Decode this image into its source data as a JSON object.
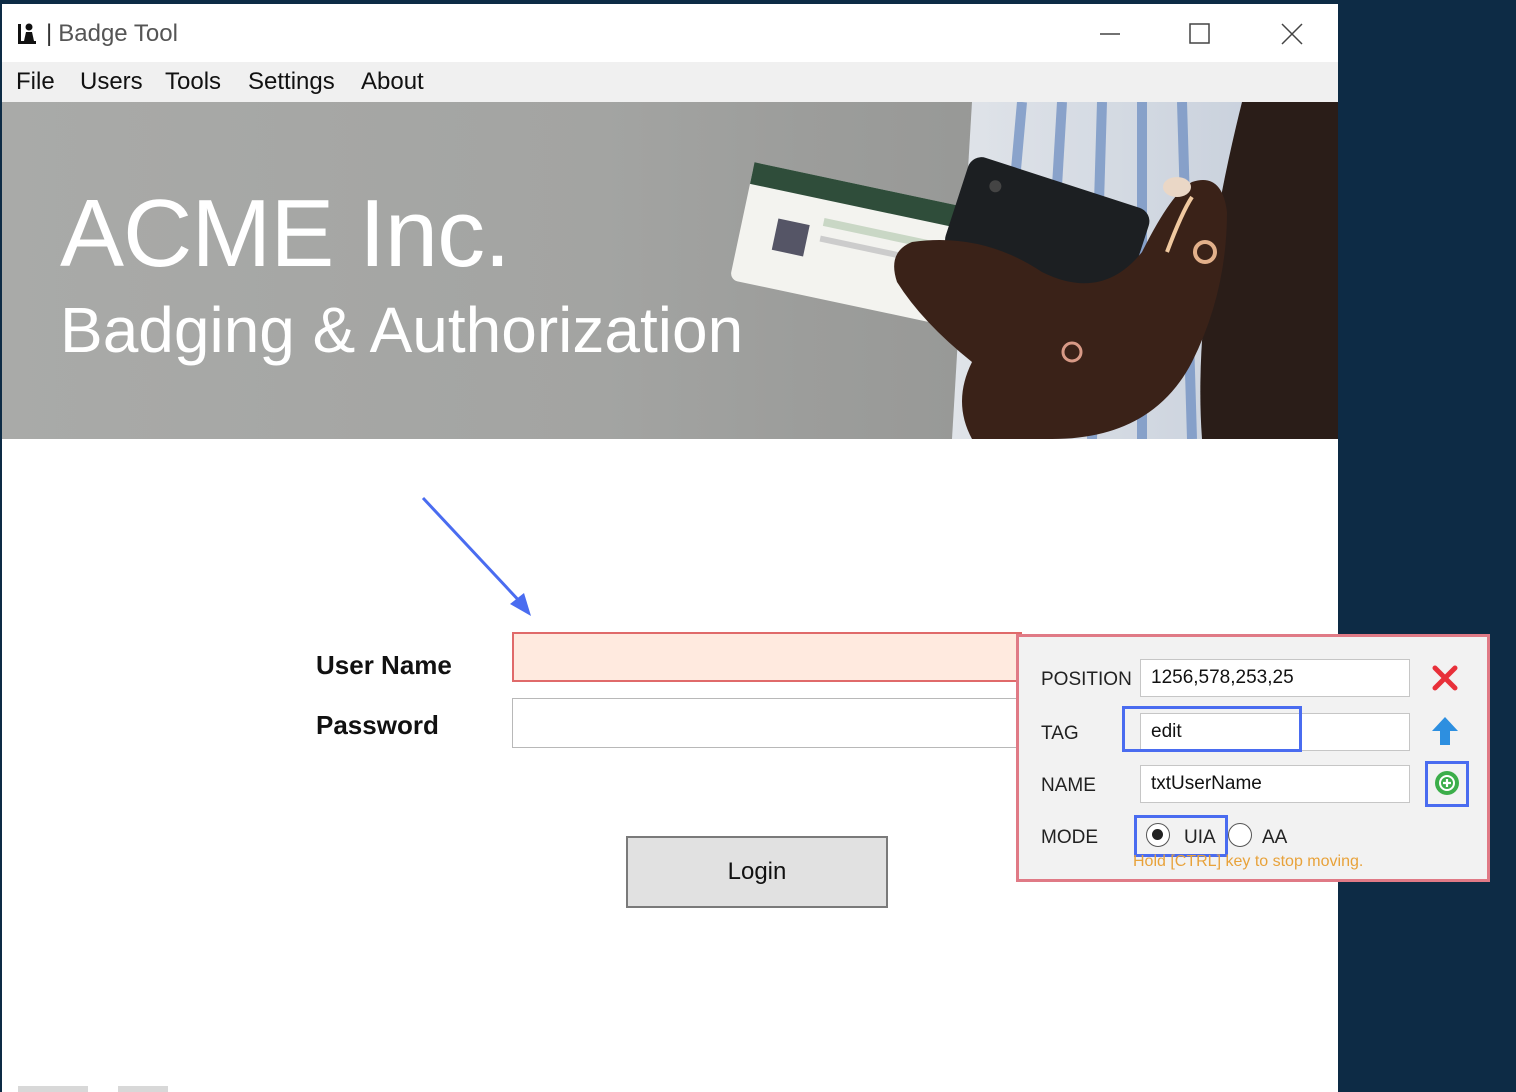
{
  "window": {
    "title": "Badge Tool",
    "title_separator": "|"
  },
  "menu": {
    "items": [
      "File",
      "Users",
      "Tools",
      "Settings",
      "About"
    ]
  },
  "banner": {
    "title": "ACME Inc.",
    "subtitle": "Badging & Authorization"
  },
  "form": {
    "username_label": "User Name",
    "username_value": "",
    "password_label": "Password",
    "password_value": "",
    "login_label": "Login"
  },
  "inspector": {
    "position_label": "POSITION",
    "position_value": "1256,578,253,25",
    "tag_label": "TAG",
    "tag_value": "edit",
    "name_label": "NAME",
    "name_value": "txtUserName",
    "mode_label": "MODE",
    "mode_options": [
      "UIA",
      "AA"
    ],
    "mode_selected": "UIA",
    "hint": "Hold [CTRL] key to stop moving."
  },
  "colors": {
    "desktop": "#0d2b45",
    "highlight_field": "#ffeadf",
    "highlight_border": "#e06a6a",
    "annotation_blue": "#4a6cf0",
    "hint_text": "#e8a23a",
    "delete_icon": "#e8303a",
    "up_icon": "#2d8fe0",
    "add_icon": "#3cae4a"
  },
  "icons": [
    "app-badge-icon",
    "minimize-icon",
    "maximize-icon",
    "close-icon",
    "delete-x-icon",
    "arrow-up-icon",
    "add-circle-icon"
  ]
}
